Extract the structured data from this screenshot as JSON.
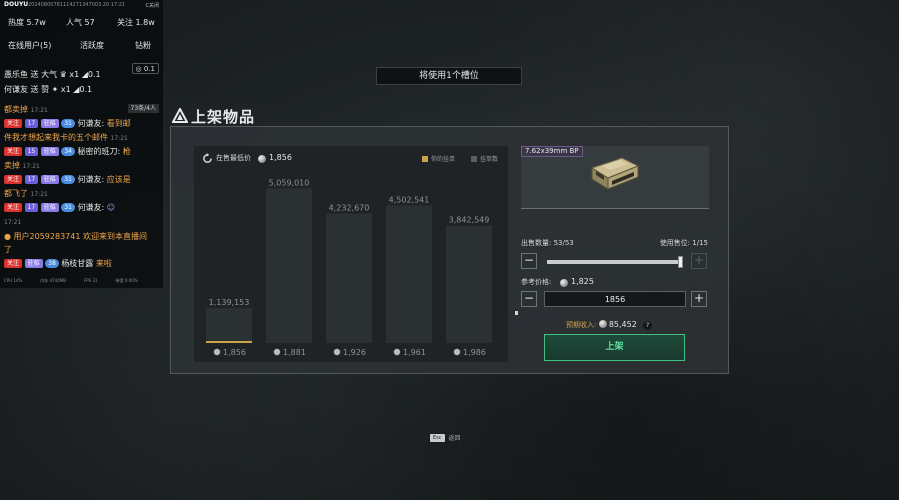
{
  "overlay": {
    "logo": "DOUYU",
    "tiny_text": "20240800781114271347003.20 17:21",
    "close_label": "C关闭",
    "stats": {
      "heat": "热度 5.7w",
      "popularity": "人气 57",
      "follow": "关注 1.8w"
    },
    "tabs": {
      "online": "在线用户(5)",
      "activity": "活跃度",
      "fans": "钻粉"
    },
    "coin_balance": "0.1",
    "gift_rows": [
      {
        "text": "愚乐鱼 送 大气",
        "count": "x1",
        "bonus": "0.1"
      },
      {
        "text": "何谦友 送 赞",
        "count": "x1",
        "bonus": "0.1"
      }
    ],
    "count_badge": "73条/4人",
    "messages": [
      {
        "text": "都卖掉",
        "time": "17:21"
      },
      {
        "follow": "关注",
        "lv": "17",
        "fan": "驻船",
        "v": "31",
        "user": "何谦友:",
        "content": "看到邮"
      },
      {
        "text": "件我才想起来我卡的五个邮件",
        "time": "17:21"
      },
      {
        "follow": "关注",
        "lv": "15",
        "fan": "驻船",
        "v": "34",
        "user": "秘密的班刀:",
        "content": "枪"
      },
      {
        "text": "卖掉",
        "time": "17:21"
      },
      {
        "follow": "关注",
        "lv": "17",
        "fan": "驻船",
        "v": "31",
        "user": "何谦友:",
        "content": "应该是"
      },
      {
        "text": "都飞了",
        "time": "17:21"
      },
      {
        "follow": "关注",
        "lv": "17",
        "fan": "驻船",
        "v": "31",
        "user": "何谦友:",
        "content": ""
      },
      {
        "text": "",
        "time": "17:21"
      },
      {
        "text": "用户2059283741 欢迎来到本直播间"
      },
      {
        "text": "了"
      },
      {
        "follow": "关注",
        "lv": "",
        "fan": "驻船",
        "v": "38",
        "user": "杨枝甘露",
        "content": "来啦"
      }
    ],
    "footer": [
      "CPU 14%",
      "内存 4740MB",
      "FPS 31",
      "带宽 0.00%"
    ]
  },
  "banner": "将使用1个槽位",
  "panel": {
    "title": "上架物品",
    "chart_header": {
      "label": "在售最低价",
      "value": "1,856",
      "legend_mine": "你的挂单",
      "legend_count": "挂单数"
    },
    "item_name": "7.62x39mm BP",
    "qty_label": "出售数量: 53/53",
    "slot_label": "使用售位: 1/15",
    "minus": "−",
    "plus": "+",
    "slider_fraction": 1.0,
    "ref_label": "参考价格:",
    "ref_value": "1,825",
    "price_value": "1856",
    "income_label": "预期收入:",
    "income_value": "85,452",
    "help": "?",
    "list_button": "上架"
  },
  "esc_hint": {
    "key": "Esc",
    "label": "返回"
  },
  "colors": {
    "accent_green": "#3fbf83",
    "mine_gold": "#c9a24a",
    "bar": "#2b3033"
  },
  "chart_data": {
    "type": "bar",
    "categories": [
      "1,856",
      "1,881",
      "1,926",
      "1,961",
      "1,986"
    ],
    "values": [
      1139153,
      5059010,
      4232670,
      4502541,
      3842549
    ],
    "value_labels": [
      "1,139,153",
      "5,059,010",
      "4,232,670",
      "4,502,541",
      "3,842,549"
    ],
    "mine_category_index": 0,
    "ylim": [
      0,
      5300000
    ]
  }
}
